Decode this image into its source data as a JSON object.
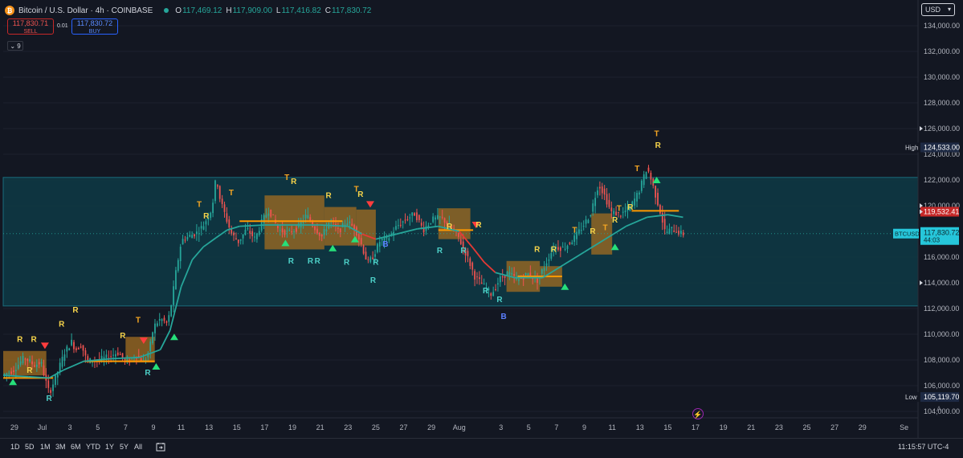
{
  "header": {
    "coin_glyph": "₿",
    "symbol": "Bitcoin / U.S. Dollar · 4h · COINBASE",
    "open_label": "O",
    "open": "117,469.12",
    "high_label": "H",
    "high": "117,909.00",
    "low_label": "L",
    "low": "117,416.82",
    "close_label": "C",
    "close": "117,830.72"
  },
  "trade": {
    "sell_price": "117,830.71",
    "sell_label": "SELL",
    "spread": "0.01",
    "buy_price": "117,830.72",
    "buy_label": "BUY"
  },
  "indicator_toggle": "⌄ 9",
  "currency": "USD",
  "timeframes": [
    "1D",
    "5D",
    "1M",
    "3M",
    "6M",
    "YTD",
    "1Y",
    "5Y",
    "All"
  ],
  "clock": "11:15:57 UTC-4",
  "settings_label": "A",
  "colors": {
    "background": "#131722",
    "up": "#26a69a",
    "down": "#ef5350",
    "range_fill": "#0e3a45",
    "range_border": "#1a6c7c",
    "zone_fill": "#9c6a21",
    "trend_up": "#26a69a",
    "trend_down": "#e53935",
    "label_r": "#f5d34a",
    "label_t": "#f5a623",
    "label_support": "#4dd0c8",
    "label_b": "#5b7fff",
    "last_price_tag": "#26c6da",
    "high_low_tag": "#1e2a44",
    "red_tag": "#c62828"
  },
  "chart_data": {
    "type": "candlestick",
    "title": "Bitcoin / U.S. Dollar · 4h · COINBASE",
    "ylim": [
      103500,
      135500
    ],
    "y_ticks": [
      104000,
      106000,
      108000,
      110000,
      112000,
      114000,
      116000,
      118000,
      120000,
      122000,
      124000,
      126000,
      128000,
      130000,
      132000,
      134000
    ],
    "y_tick_labels": [
      "104,000.00",
      "106,000.00",
      "108,000.00",
      "110,000.00",
      "112,000.00",
      "114,000.00",
      "116,000.00",
      "118,000.00",
      "120,000.00",
      "122,000.00",
      "124,000.00",
      "126,000.00",
      "128,000.00",
      "130,000.00",
      "132,000.00",
      "134,000.00"
    ],
    "x_tick_labels": [
      "29",
      "Jul",
      "3",
      "5",
      "7",
      "9",
      "11",
      "13",
      "15",
      "17",
      "19",
      "21",
      "23",
      "25",
      "27",
      "29",
      "Aug",
      "3",
      "5",
      "7",
      "9",
      "11",
      "13",
      "15",
      "17",
      "19",
      "21",
      "23",
      "25",
      "27",
      "29",
      "Se"
    ],
    "x_tick_days": [
      -2,
      0,
      2,
      4,
      6,
      8,
      10,
      12,
      14,
      16,
      18,
      20,
      22,
      24,
      26,
      28,
      30,
      33,
      35,
      37,
      39,
      41,
      43,
      45,
      47,
      49,
      51,
      53,
      55,
      57,
      59,
      62
    ],
    "x_range_days": [
      -2.8,
      63
    ],
    "price_path": [
      [
        -2.8,
        106800
      ],
      [
        -2,
        107200
      ],
      [
        -1.2,
        108200
      ],
      [
        -0.5,
        107600
      ],
      [
        0,
        107800
      ],
      [
        0.3,
        106500
      ],
      [
        0.6,
        105400
      ],
      [
        1.1,
        106800
      ],
      [
        1.7,
        108600
      ],
      [
        2.2,
        109400
      ],
      [
        2.5,
        108800
      ],
      [
        2.9,
        109200
      ],
      [
        3.3,
        107900
      ],
      [
        4,
        108000
      ],
      [
        4.8,
        108200
      ],
      [
        5.5,
        108600
      ],
      [
        6.2,
        107800
      ],
      [
        6.8,
        108400
      ],
      [
        7.4,
        107800
      ],
      [
        7.8,
        108800
      ],
      [
        8.1,
        110600
      ],
      [
        8.6,
        111200
      ],
      [
        9.1,
        110800
      ],
      [
        9.4,
        112500
      ],
      [
        9.7,
        114800
      ],
      [
        10.1,
        117300
      ],
      [
        10.6,
        117600
      ],
      [
        11.2,
        117900
      ],
      [
        11.7,
        118500
      ],
      [
        12.3,
        119800
      ],
      [
        12.6,
        122300
      ],
      [
        12.9,
        120400
      ],
      [
        13.3,
        119100
      ],
      [
        13.7,
        117800
      ],
      [
        14.2,
        117200
      ],
      [
        14.8,
        118200
      ],
      [
        15.4,
        117400
      ],
      [
        15.9,
        118800
      ],
      [
        16.4,
        119700
      ],
      [
        17.1,
        118100
      ],
      [
        17.8,
        117900
      ],
      [
        18.5,
        118300
      ],
      [
        19.1,
        119300
      ],
      [
        19.6,
        118400
      ],
      [
        20.2,
        117600
      ],
      [
        20.8,
        118900
      ],
      [
        21.4,
        118000
      ],
      [
        22,
        118800
      ],
      [
        22.6,
        118200
      ],
      [
        23,
        117100
      ],
      [
        23.5,
        115500
      ],
      [
        23.9,
        116100
      ],
      [
        24.4,
        117300
      ],
      [
        25,
        117500
      ],
      [
        25.6,
        118400
      ],
      [
        26.2,
        118900
      ],
      [
        26.9,
        119400
      ],
      [
        27.5,
        118100
      ],
      [
        28.1,
        118900
      ],
      [
        28.8,
        119100
      ],
      [
        29.4,
        118400
      ],
      [
        30,
        117600
      ],
      [
        30.6,
        116200
      ],
      [
        31.2,
        114500
      ],
      [
        31.8,
        113800
      ],
      [
        32.4,
        113100
      ],
      [
        33,
        114300
      ],
      [
        33.6,
        114800
      ],
      [
        34.3,
        114200
      ],
      [
        35,
        114700
      ],
      [
        35.7,
        114200
      ],
      [
        36.3,
        115500
      ],
      [
        36.9,
        116800
      ],
      [
        37.6,
        116700
      ],
      [
        38.3,
        117400
      ],
      [
        38.9,
        118300
      ],
      [
        39.5,
        119300
      ],
      [
        40.1,
        121700
      ],
      [
        40.5,
        120900
      ],
      [
        41,
        119500
      ],
      [
        41.7,
        119300
      ],
      [
        42.4,
        119900
      ],
      [
        43,
        121100
      ],
      [
        43.6,
        123000
      ],
      [
        44,
        121600
      ],
      [
        44.5,
        119700
      ],
      [
        44.9,
        117900
      ],
      [
        45.4,
        118200
      ],
      [
        46.1,
        117800
      ]
    ],
    "trend_line": [
      [
        -2.8,
        106800
      ],
      [
        -1,
        106700
      ],
      [
        0.5,
        106600
      ],
      [
        1.5,
        107200
      ],
      [
        3,
        107900
      ],
      [
        5,
        108100
      ],
      [
        7,
        108200
      ],
      [
        8.5,
        108800
      ],
      [
        9.2,
        110300
      ],
      [
        10,
        113700
      ],
      [
        10.8,
        115800
      ],
      [
        11.6,
        116800
      ],
      [
        12.5,
        117500
      ],
      [
        13.3,
        118100
      ],
      [
        14.2,
        118400
      ],
      [
        16,
        118500
      ],
      [
        18,
        118500
      ],
      [
        20,
        118500
      ],
      [
        22,
        118400
      ],
      [
        23,
        117800
      ],
      [
        24,
        117400
      ],
      [
        25.5,
        117800
      ],
      [
        27,
        118200
      ],
      [
        28.5,
        118400
      ],
      [
        30,
        118000
      ],
      [
        31,
        116700
      ],
      [
        31.8,
        115600
      ],
      [
        32.6,
        114800
      ],
      [
        34,
        114400
      ],
      [
        36,
        114400
      ],
      [
        37.5,
        115400
      ],
      [
        39,
        116400
      ],
      [
        40.5,
        117400
      ],
      [
        42,
        118400
      ],
      [
        43.5,
        119100
      ],
      [
        45,
        119300
      ],
      [
        46.1,
        119100
      ]
    ],
    "trend_segments": [
      {
        "from": -2.8,
        "to": 1.0,
        "direction": "up"
      },
      {
        "from": 23.0,
        "to": 24.0,
        "direction": "down"
      },
      {
        "from": 30.0,
        "to": 32.6,
        "direction": "down"
      }
    ],
    "range_box": {
      "y_bottom": 112200,
      "y_top": 122200
    },
    "zones": [
      {
        "x0": -2.8,
        "x1": 0.3,
        "y0": 106800,
        "y1": 108700
      },
      {
        "x0": 6.0,
        "x1": 8.1,
        "y0": 107800,
        "y1": 109800
      },
      {
        "x0": 16.0,
        "x1": 20.3,
        "y0": 116600,
        "y1": 120800
      },
      {
        "x0": 20.3,
        "x1": 22.6,
        "y0": 116900,
        "y1": 119900
      },
      {
        "x0": 22.6,
        "x1": 24.0,
        "y0": 116900,
        "y1": 119700
      },
      {
        "x0": 28.5,
        "x1": 30.8,
        "y0": 117400,
        "y1": 119800
      },
      {
        "x0": 33.4,
        "x1": 35.8,
        "y0": 113300,
        "y1": 115700
      },
      {
        "x0": 35.8,
        "x1": 37.4,
        "y0": 113700,
        "y1": 115300
      },
      {
        "x0": 39.5,
        "x1": 41.0,
        "y0": 116200,
        "y1": 119400
      }
    ],
    "level_lines": [
      {
        "x0": -2.8,
        "x1": 0.8,
        "y": 106600
      },
      {
        "x0": 3.0,
        "x1": 8.1,
        "y": 107900
      },
      {
        "x0": 14.2,
        "x1": 21.6,
        "y": 118800
      },
      {
        "x0": 28.5,
        "x1": 31.0,
        "y": 118100
      },
      {
        "x0": 34.2,
        "x1": 37.4,
        "y": 114500
      },
      {
        "x0": 42.4,
        "x1": 45.8,
        "y": 119600
      }
    ],
    "signals_up": [
      [
        -2.1,
        106800
      ],
      [
        8.2,
        108000
      ],
      [
        9.5,
        110300
      ],
      [
        17.5,
        117600
      ],
      [
        20.9,
        117200
      ],
      [
        22.5,
        117900
      ],
      [
        37.6,
        114200
      ],
      [
        41.2,
        117300
      ],
      [
        44.2,
        122500
      ]
    ],
    "signals_down": [
      [
        0.2,
        108600
      ],
      [
        7.3,
        109000
      ],
      [
        23.6,
        119600
      ],
      [
        31.2,
        118000
      ]
    ],
    "labels": [
      {
        "text": "R",
        "x": -1.6,
        "y": 109400,
        "kind": "r"
      },
      {
        "text": "R",
        "x": -0.6,
        "y": 109400,
        "kind": "r"
      },
      {
        "text": "R",
        "x": -0.9,
        "y": 107000,
        "kind": "r"
      },
      {
        "text": "R",
        "x": 0.5,
        "y": 104800,
        "kind": "support"
      },
      {
        "text": "R",
        "x": 1.4,
        "y": 110600,
        "kind": "r"
      },
      {
        "text": "R",
        "x": 2.4,
        "y": 111700,
        "kind": "r"
      },
      {
        "text": "R",
        "x": 5.8,
        "y": 109700,
        "kind": "r"
      },
      {
        "text": "T",
        "x": 6.9,
        "y": 110900,
        "kind": "t"
      },
      {
        "text": "R",
        "x": 7.6,
        "y": 106800,
        "kind": "support"
      },
      {
        "text": "T",
        "x": 11.3,
        "y": 119900,
        "kind": "t"
      },
      {
        "text": "R",
        "x": 11.8,
        "y": 119000,
        "kind": "r"
      },
      {
        "text": "T",
        "x": 13.6,
        "y": 120800,
        "kind": "t"
      },
      {
        "text": "T",
        "x": 17.6,
        "y": 122000,
        "kind": "t"
      },
      {
        "text": "R",
        "x": 18.1,
        "y": 121700,
        "kind": "r"
      },
      {
        "text": "R",
        "x": 17.9,
        "y": 115500,
        "kind": "support"
      },
      {
        "text": "R",
        "x": 19.3,
        "y": 115500,
        "kind": "support"
      },
      {
        "text": "R",
        "x": 19.8,
        "y": 115500,
        "kind": "support"
      },
      {
        "text": "R",
        "x": 20.6,
        "y": 120600,
        "kind": "r"
      },
      {
        "text": "R",
        "x": 21.9,
        "y": 115400,
        "kind": "support"
      },
      {
        "text": "T",
        "x": 22.6,
        "y": 121100,
        "kind": "t"
      },
      {
        "text": "R",
        "x": 22.9,
        "y": 120700,
        "kind": "r"
      },
      {
        "text": "B",
        "x": 24.7,
        "y": 116800,
        "kind": "b"
      },
      {
        "text": "R",
        "x": 24.0,
        "y": 115400,
        "kind": "support"
      },
      {
        "text": "R",
        "x": 23.8,
        "y": 114000,
        "kind": "support"
      },
      {
        "text": "R",
        "x": 28.6,
        "y": 116300,
        "kind": "support"
      },
      {
        "text": "R",
        "x": 29.3,
        "y": 118200,
        "kind": "r"
      },
      {
        "text": "R",
        "x": 31.4,
        "y": 118300,
        "kind": "r"
      },
      {
        "text": "R",
        "x": 30.3,
        "y": 116300,
        "kind": "support"
      },
      {
        "text": "R",
        "x": 31.9,
        "y": 113200,
        "kind": "support"
      },
      {
        "text": "R",
        "x": 32.9,
        "y": 112500,
        "kind": "support"
      },
      {
        "text": "B",
        "x": 33.2,
        "y": 111200,
        "kind": "b"
      },
      {
        "text": "R",
        "x": 35.6,
        "y": 116400,
        "kind": "r"
      },
      {
        "text": "R",
        "x": 36.8,
        "y": 116400,
        "kind": "r"
      },
      {
        "text": "T",
        "x": 38.3,
        "y": 117900,
        "kind": "t"
      },
      {
        "text": "R",
        "x": 39.6,
        "y": 117800,
        "kind": "r"
      },
      {
        "text": "T",
        "x": 40.5,
        "y": 118100,
        "kind": "t"
      },
      {
        "text": "R",
        "x": 41.2,
        "y": 118700,
        "kind": "r"
      },
      {
        "text": "T",
        "x": 41.5,
        "y": 119600,
        "kind": "t"
      },
      {
        "text": "R",
        "x": 42.3,
        "y": 119700,
        "kind": "r"
      },
      {
        "text": "T",
        "x": 42.8,
        "y": 122700,
        "kind": "t"
      },
      {
        "text": "T",
        "x": 44.2,
        "y": 125400,
        "kind": "t"
      },
      {
        "text": "R",
        "x": 44.3,
        "y": 124500,
        "kind": "r"
      }
    ],
    "price_tags": [
      {
        "label": "High",
        "value": "124,533.00",
        "y": 124533,
        "style": "hl"
      },
      {
        "label": "",
        "value": "119,532.41",
        "y": 119532,
        "style": "red"
      },
      {
        "label": "BTCUSD",
        "value": "117,830.72",
        "sub": "44:03",
        "y": 117830,
        "style": "last"
      },
      {
        "label": "Low",
        "value": "105,119.70",
        "y": 105119,
        "style": "hl"
      }
    ],
    "tick_arrows": [
      126000,
      120000,
      114000
    ],
    "price_line_y": 119532,
    "last_price": 117830.72
  }
}
